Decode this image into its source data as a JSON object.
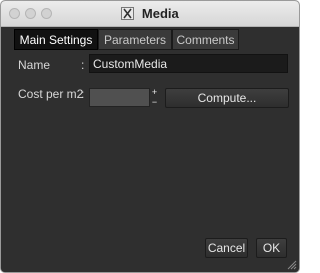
{
  "window": {
    "title": "Media"
  },
  "tabs": [
    {
      "label": "Main Settings",
      "active": true
    },
    {
      "label": "Parameters",
      "active": false
    },
    {
      "label": "Comments",
      "active": false
    }
  ],
  "form": {
    "name_label": "Name",
    "colon": ":",
    "name_value": "CustomMedia",
    "cost_label": "Cost per m2",
    "cost_value": "",
    "spin_up": "+",
    "spin_down": "−",
    "compute_label": "Compute..."
  },
  "footer": {
    "cancel_label": "Cancel",
    "ok_label": "OK"
  },
  "icons": {
    "traffic": [
      "close-icon",
      "minimize-icon",
      "zoom-icon"
    ],
    "title_icon": "x11-icon",
    "resize_icon": "resize-grip-icon"
  },
  "colors": {
    "background": "#2f2f2f",
    "active_tab": "#111111",
    "field_dark": "#1b1b1b",
    "field_gray": "#505050"
  }
}
